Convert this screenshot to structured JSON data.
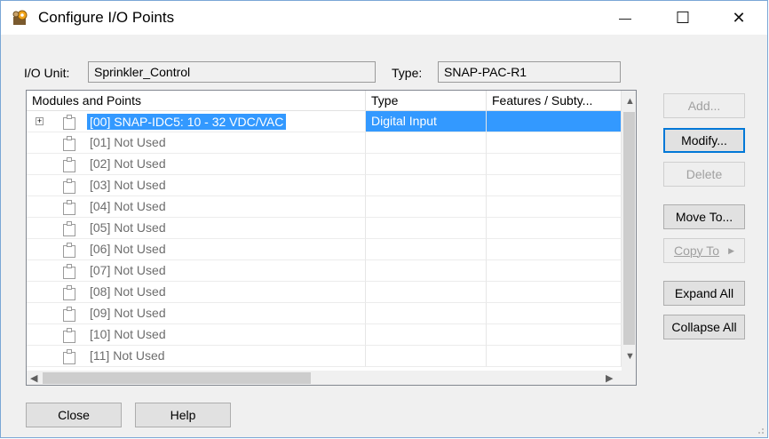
{
  "window": {
    "title": "Configure I/O Points",
    "controls": {
      "minimize": "—",
      "maximize": "☐",
      "close": "✕"
    }
  },
  "io_unit": {
    "label": "I/O Unit:",
    "value": "Sprinkler_Control"
  },
  "type_field": {
    "label": "Type:",
    "value": "SNAP-PAC-R1"
  },
  "table": {
    "columns": [
      "Modules and Points",
      "Type",
      "Features / Subty..."
    ],
    "rows": [
      {
        "expander": "+",
        "name": "[00] SNAP-IDC5: 10 - 32 VDC/VAC",
        "type": "Digital Input",
        "features": "",
        "selected": true
      },
      {
        "name": "[01] Not Used",
        "type": "",
        "features": ""
      },
      {
        "name": "[02] Not Used",
        "type": "",
        "features": ""
      },
      {
        "name": "[03] Not Used",
        "type": "",
        "features": ""
      },
      {
        "name": "[04] Not Used",
        "type": "",
        "features": ""
      },
      {
        "name": "[05] Not Used",
        "type": "",
        "features": ""
      },
      {
        "name": "[06] Not Used",
        "type": "",
        "features": ""
      },
      {
        "name": "[07] Not Used",
        "type": "",
        "features": ""
      },
      {
        "name": "[08] Not Used",
        "type": "",
        "features": ""
      },
      {
        "name": "[09] Not Used",
        "type": "",
        "features": ""
      },
      {
        "name": "[10] Not Used",
        "type": "",
        "features": ""
      },
      {
        "name": "[11] Not Used",
        "type": "",
        "features": ""
      }
    ]
  },
  "buttons": {
    "add": "Add...",
    "modify": "Modify...",
    "delete": "Delete",
    "move_to": "Move To...",
    "copy_to": "Copy To",
    "copy_to_arrow": "▶",
    "expand_all": "Expand All",
    "collapse_all": "Collapse All",
    "close": "Close",
    "help": "Help"
  },
  "scroll_arrows": {
    "up": "▲",
    "down": "▼",
    "left": "◀",
    "right": "▶"
  },
  "colors": {
    "selection": "#3399ff",
    "default_button_border": "#0078d7",
    "window_border": "#7aa7d6"
  }
}
